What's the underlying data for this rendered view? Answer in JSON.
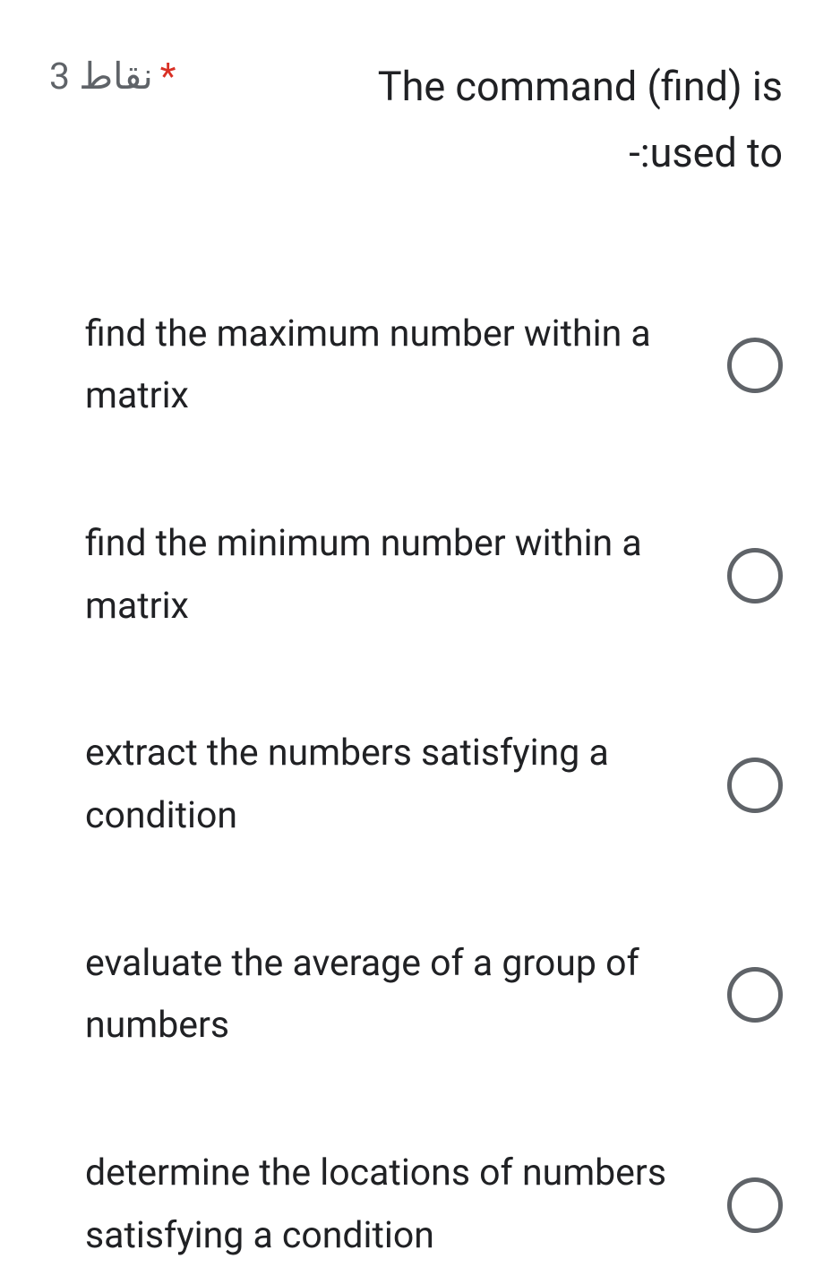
{
  "question": {
    "points_label": "3 نقاط",
    "required_marker": "*",
    "text_line1": "The command (find) is",
    "text_line2": "-:used to"
  },
  "options": [
    {
      "label": "find the maximum number within a matrix"
    },
    {
      "label": "find the minimum number within a matrix"
    },
    {
      "label": "extract the numbers satisfying a condition"
    },
    {
      "label": "evaluate the average of a group of numbers"
    },
    {
      "label": "determine the locations of numbers satisfying a condition"
    }
  ]
}
